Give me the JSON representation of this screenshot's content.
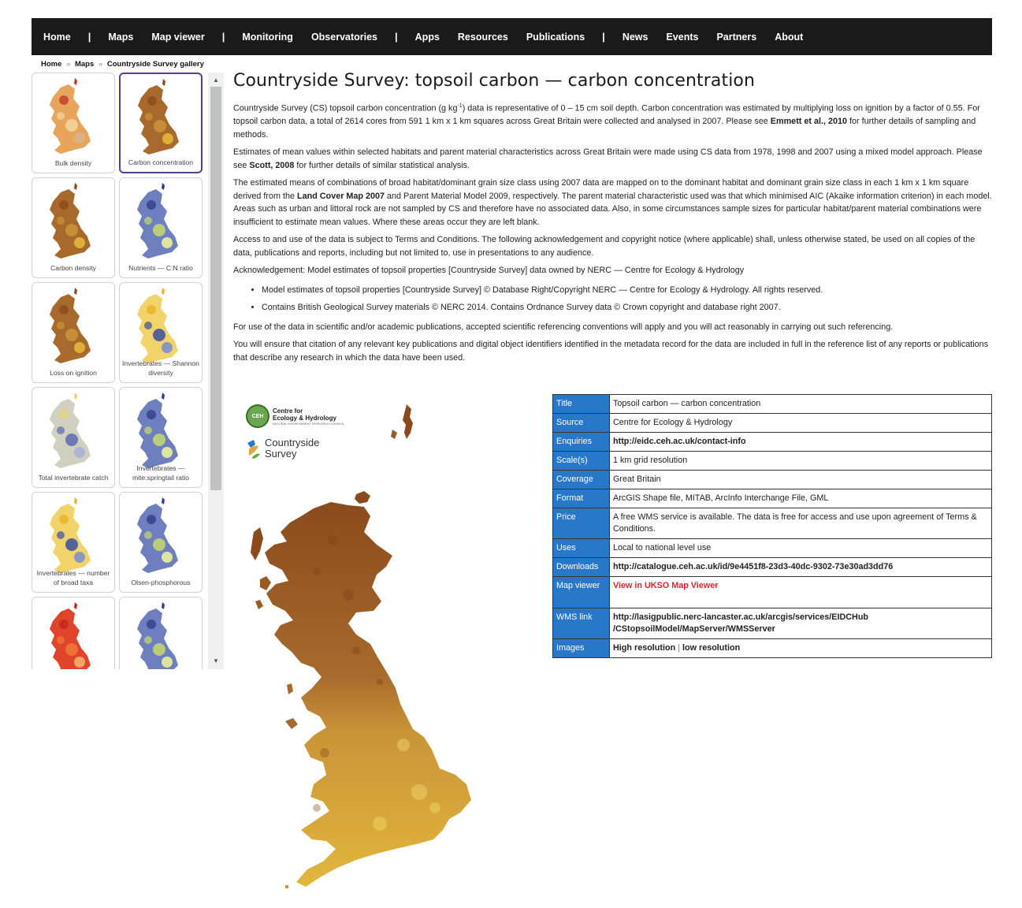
{
  "nav": {
    "items": [
      {
        "label": "Home"
      },
      {
        "sep": "|"
      },
      {
        "label": "Maps"
      },
      {
        "label": "Map viewer"
      },
      {
        "sep": "|"
      },
      {
        "label": "Monitoring"
      },
      {
        "label": "Observatories"
      },
      {
        "sep": "|"
      },
      {
        "label": "Apps"
      },
      {
        "label": "Resources"
      },
      {
        "label": "Publications"
      },
      {
        "sep": "|"
      },
      {
        "label": "News"
      },
      {
        "label": "Events"
      },
      {
        "label": "Partners"
      },
      {
        "label": "About"
      }
    ]
  },
  "breadcrumb": {
    "home": "Home",
    "sep": "»",
    "maps": "Maps",
    "current": "Countryside Survey gallery"
  },
  "gallery": {
    "items": [
      {
        "caption": "Bulk density",
        "palette": "reds",
        "active": false
      },
      {
        "caption": "Carbon concentration",
        "palette": "browns",
        "active": true
      },
      {
        "caption": "Carbon density",
        "palette": "browns",
        "active": false
      },
      {
        "caption": "Nutrients — C:N ratio",
        "palette": "bluegreen",
        "active": false
      },
      {
        "caption": "Loss on ignition",
        "palette": "browns",
        "active": false
      },
      {
        "caption": "Invertebrates — Shannon diversity",
        "palette": "yellowblue",
        "active": false
      },
      {
        "caption": "Total invertebrate catch",
        "palette": "paleblue",
        "active": false
      },
      {
        "caption": "Invertebrates — mite:springtail ratio",
        "palette": "bluegreen",
        "active": false
      },
      {
        "caption": "Invertebrates — number of broad taxa",
        "palette": "yellowblue",
        "active": false
      },
      {
        "caption": "Olsen-phosphorous",
        "palette": "bluegreen",
        "active": false
      },
      {
        "caption": "",
        "palette": "redsdark",
        "active": false
      },
      {
        "caption": "",
        "palette": "bluegreen",
        "active": false
      }
    ]
  },
  "page": {
    "title": "Countryside Survey: topsoil carbon — carbon concentration",
    "p1_a": "Countryside Survey (CS) topsoil carbon concentration (g kg",
    "p1_sup": "-1",
    "p1_b": ") data is representative of 0 – 15 cm soil depth. Carbon concentration was estimated by multiplying loss on ignition by a factor of 0.55. For topsoil carbon data, a total of 2614 cores from 591 1 km x 1 km squares across Great Britain were collected and analysed in 2007. Please see ",
    "p1_link": "Emmett et al., 2010",
    "p1_c": " for further details of sampling and methods.",
    "p2_a": "Estimates of mean values within selected habitats and parent material characteristics across Great Britain were made using CS data from 1978, 1998 and 2007 using a mixed model approach. Please see ",
    "p2_link": "Scott, 2008",
    "p2_b": " for further details of similar statistical analysis.",
    "p3_a": "The estimated means of combinations of broad habitat/dominant grain size class using 2007 data are mapped on to the dominant habitat and dominant grain size class in each 1 km x 1 km square derived from the ",
    "p3_link": "Land Cover Map 2007",
    "p3_b": " and Parent Material Model 2009, respectively. The parent material characteristic used was that which minimised AIC (Akaike information criterion) in each model. Areas such as urban and littoral rock are not sampled by CS and therefore have no associated data. Also, in some circumstances sample sizes for particular habitat/parent material combinations were insufficient to estimate mean values. Where these areas occur they are left blank.",
    "p4": "Access to and use of the data is subject to Terms and Conditions. The following acknowledgement and copyright notice (where applicable) shall, unless otherwise stated, be used on all copies of the data, publications and reports, including but not limited to, use in presentations to any audience.",
    "p5": "Acknowledgement: Model estimates of topsoil properties [Countryside Survey] data owned by NERC — Centre for Ecology & Hydrology",
    "bullets": [
      "Model estimates of topsoil properties [Countryside Survey] © Database Right/Copyright NERC — Centre for Ecology & Hydrology. All rights reserved.",
      "Contains British Geological Survey materials © NERC 2014. Contains Ordnance Survey data © Crown copyright and database right 2007."
    ],
    "p6": "For use of the data in scientific and/or academic publications, accepted scientific referencing conventions will apply and you will act reasonably in carrying out such referencing.",
    "p7": "You will ensure that citation of any relevant key publications and digital object identifiers identified in the metadata record for the data are included in full in the reference list of any reports or publications that describe any research in which the data have been used."
  },
  "logos": {
    "ceh_mark": "CEH",
    "ceh_line1": "Centre for",
    "ceh_line2": "Ecology & Hydrology",
    "ceh_sub": "NATURAL ENVIRONMENT RESEARCH COUNCIL",
    "cs_line1": "Countryside",
    "cs_line2": "Survey"
  },
  "table": {
    "title": {
      "k": "Title",
      "v": "Topsoil carbon — carbon concentration"
    },
    "source": {
      "k": "Source",
      "v": "Centre for Ecology & Hydrology"
    },
    "enquiries": {
      "k": "Enquiries",
      "v": "http://eidc.ceh.ac.uk/contact-info"
    },
    "scale": {
      "k": "Scale(s)",
      "v": "1 km grid resolution"
    },
    "coverage": {
      "k": "Coverage",
      "v": "Great Britain"
    },
    "format": {
      "k": "Format",
      "v": "ArcGIS Shape file, MITAB, ArcInfo Interchange File, GML"
    },
    "price": {
      "k": "Price",
      "v": "A free WMS service is available. The data is free for access and use upon agreement of Terms & Conditions."
    },
    "uses": {
      "k": "Uses",
      "v": "Local to national level use"
    },
    "downloads": {
      "k": "Downloads",
      "v": "http://catalogue.ceh.ac.uk/id/9e4451f8-23d3-40dc-9302-73e30ad3dd76"
    },
    "mapviewer": {
      "k": "Map viewer",
      "v": "View in UKSO Map Viewer"
    },
    "wms": {
      "k": "WMS link",
      "v1": "http://lasigpublic.nerc-lancaster.ac.uk/arcgis/services/EIDCHub",
      "v2": "/CStopsoilModel/MapServer/WMSServer"
    },
    "images": {
      "k": "Images",
      "hi": "High resolution",
      "sep": "|",
      "lo": "low resolution"
    }
  },
  "colors": {
    "nav_bg": "#1a1a1a",
    "table_key_bg": "#2877c8",
    "link_red": "#e0222a",
    "active_thumb_border": "#5a3e8c",
    "map_dark": "#8b4a1c",
    "map_light": "#e2b63c"
  },
  "scrollbar": {
    "up": "▲",
    "down": "▼"
  }
}
